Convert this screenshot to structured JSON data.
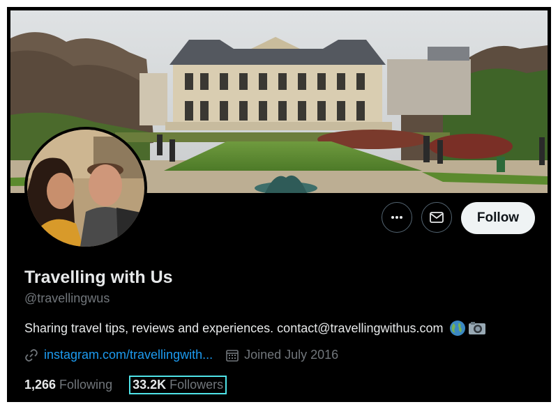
{
  "profile": {
    "name": "Travelling with Us",
    "handle": "@travellingwus",
    "bio": "Sharing travel tips, reviews and experiences. contact@travellingwithus.com",
    "bio_emoji": [
      "globe-icon",
      "camera-icon"
    ],
    "website": "instagram.com/travellingwith...",
    "joined": "Joined July 2016"
  },
  "stats": {
    "following_count": "1,266",
    "following_label": "Following",
    "followers_count": "33.2K",
    "followers_label": "Followers"
  },
  "actions": {
    "more_icon": "more-icon",
    "message_icon": "envelope-icon",
    "follow_label": "Follow"
  },
  "colors": {
    "background": "#000000",
    "primary_text": "#e7e9ea",
    "secondary_text": "#71767b",
    "link": "#1d9bf0",
    "follow_button_bg": "#eff3f4",
    "highlight_outline": "#4fe3e8"
  }
}
